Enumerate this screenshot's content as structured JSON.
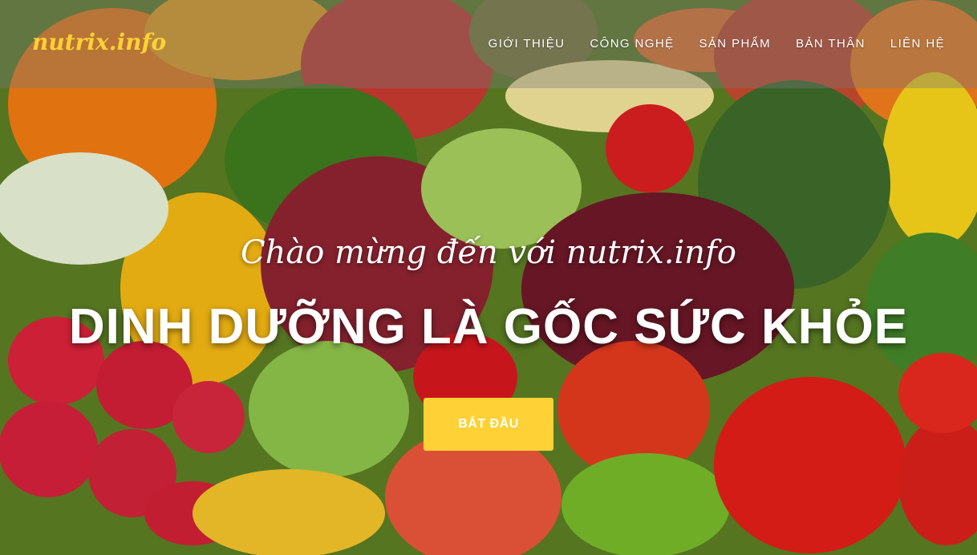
{
  "navbar": {
    "brand": "nutrix.info",
    "items": [
      {
        "label": "GIỚI THIỆU"
      },
      {
        "label": "CÔNG NGHỆ"
      },
      {
        "label": "SẢN PHẨM"
      },
      {
        "label": "BẢN THÂN"
      },
      {
        "label": "LIÊN HỆ"
      }
    ]
  },
  "hero": {
    "subheading": "Chào mừng đến với nutrix.info",
    "heading": "DINH DƯỠNG LÀ GỐC SỨC KHỎE",
    "button_label": "BẮT ĐẦU"
  },
  "colors": {
    "accent": "#fed136",
    "text": "#ffffff"
  }
}
